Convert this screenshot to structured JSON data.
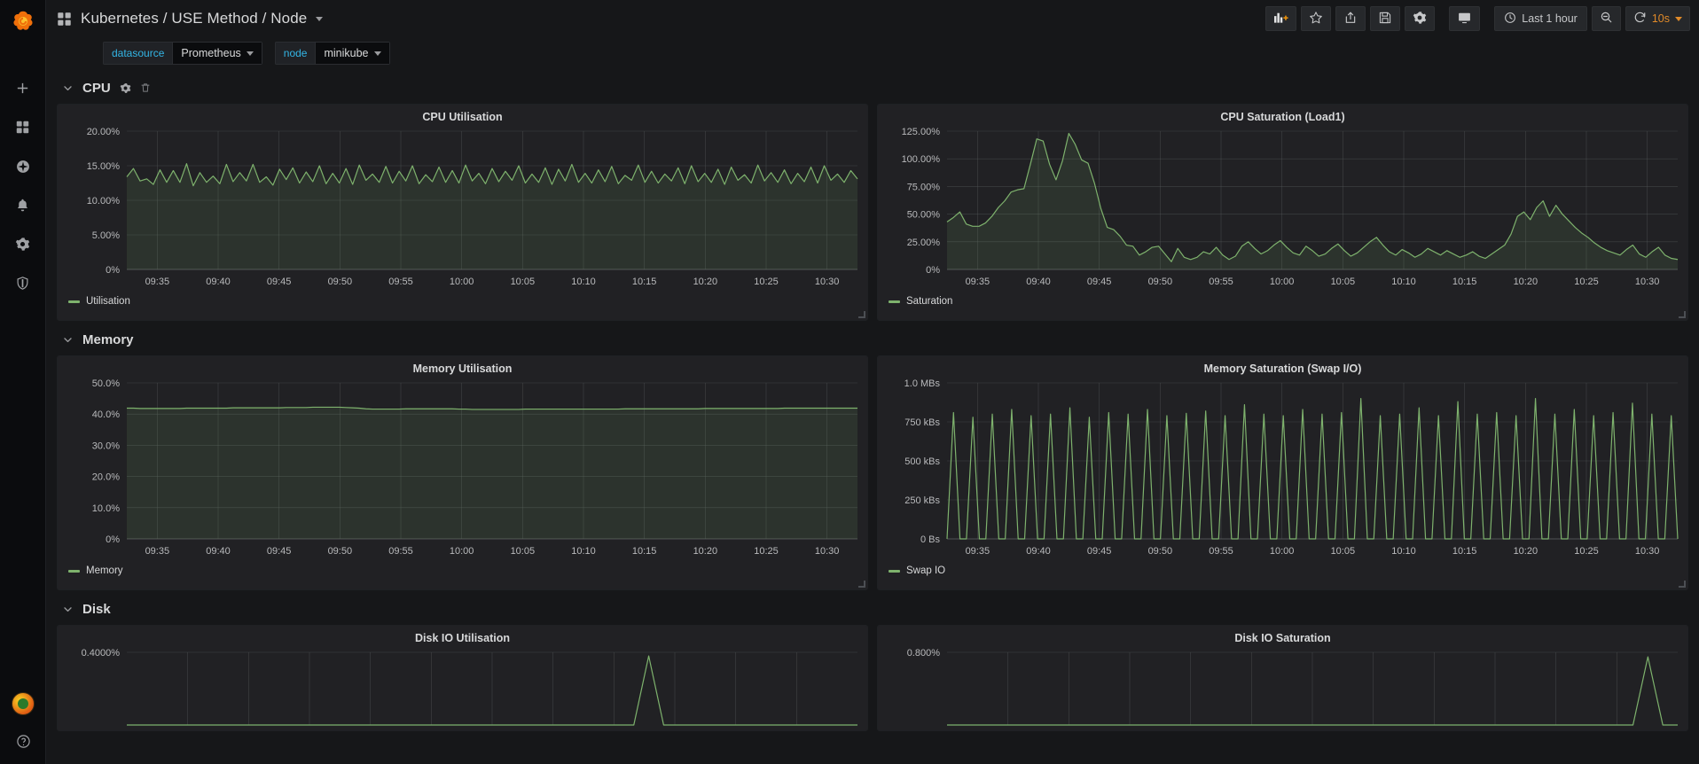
{
  "sidebar": {
    "logo_icon": "grafana-logo-icon",
    "items": [
      {
        "name": "create-button",
        "icon": "plus-icon"
      },
      {
        "name": "dashboards-nav",
        "icon": "apps-grid-icon"
      },
      {
        "name": "explore-nav",
        "icon": "compass-icon"
      },
      {
        "name": "alerting-nav",
        "icon": "bell-icon"
      },
      {
        "name": "configuration-nav",
        "icon": "gear-icon"
      },
      {
        "name": "server-admin-nav",
        "icon": "shield-icon"
      }
    ],
    "bottom": [
      {
        "name": "user-avatar",
        "icon": "avatar-icon"
      },
      {
        "name": "help-nav",
        "icon": "question-circle-icon"
      }
    ]
  },
  "navbar": {
    "dashboard_icon": "dashboard-grid-icon",
    "title": "Kubernetes / USE Method / Node",
    "title_caret": "chevron-down-icon",
    "buttons": [
      {
        "name": "add-panel-button",
        "icon": "add-panel-icon",
        "label": ""
      },
      {
        "name": "star-dashboard-button",
        "icon": "star-icon",
        "label": ""
      },
      {
        "name": "share-dashboard-button",
        "icon": "share-icon",
        "label": ""
      },
      {
        "name": "save-dashboard-button",
        "icon": "save-disk-icon",
        "label": ""
      },
      {
        "name": "dashboard-settings-button",
        "icon": "gear-icon",
        "label": ""
      },
      {
        "name": "kiosk-mode-button",
        "icon": "monitor-icon",
        "label": ""
      }
    ],
    "time_picker": {
      "icon": "clock-icon",
      "label": "Last 1 hour"
    },
    "zoom_out": {
      "icon": "zoom-out-icon"
    },
    "refresh": {
      "icon": "refresh-icon",
      "interval": "10s",
      "caret": "chevron-down-icon"
    }
  },
  "template_vars": [
    {
      "label": "datasource",
      "value": "Prometheus",
      "caret": "chevron-down-icon"
    },
    {
      "label": "node",
      "value": "minikube",
      "caret": "chevron-down-icon"
    }
  ],
  "rows": [
    {
      "title": "CPU",
      "chevron": "chevron-down-icon",
      "actions": [
        {
          "name": "row-settings-button",
          "icon": "gear-icon"
        },
        {
          "name": "row-delete-button",
          "icon": "trash-icon"
        }
      ]
    },
    {
      "title": "Memory",
      "chevron": "chevron-down-icon",
      "actions": []
    },
    {
      "title": "Disk",
      "chevron": "chevron-down-icon",
      "actions": []
    }
  ],
  "panels": {
    "cpu_utilisation": {
      "title": "CPU Utilisation",
      "legend": "Utilisation"
    },
    "cpu_saturation": {
      "title": "CPU Saturation (Load1)",
      "legend": "Saturation"
    },
    "memory_utilisation": {
      "title": "Memory Utilisation",
      "legend": "Memory"
    },
    "memory_saturation": {
      "title": "Memory Saturation (Swap I/O)",
      "legend": "Swap IO"
    },
    "disk_utilisation": {
      "title": "Disk IO Utilisation"
    },
    "disk_saturation": {
      "title": "Disk IO Saturation"
    }
  },
  "colors": {
    "series_green": "#7eb26d",
    "panel_bg": "#212124",
    "page_bg": "#161719",
    "accent_blue": "#33b5e5",
    "accent_orange": "#e08a29"
  },
  "chart_data": [
    {
      "id": "cpu_utilisation",
      "type": "line",
      "title": "CPU Utilisation",
      "xlabel": "",
      "ylabel": "",
      "ylim": [
        0,
        20
      ],
      "ytick_labels": [
        "0%",
        "5.00%",
        "10.00%",
        "15.00%",
        "20.00%"
      ],
      "ytick_values": [
        0,
        5,
        10,
        15,
        20
      ],
      "xtick_labels": [
        "09:35",
        "09:40",
        "09:45",
        "09:50",
        "09:55",
        "10:00",
        "10:05",
        "10:10",
        "10:15",
        "10:20",
        "10:25",
        "10:30"
      ],
      "grid": true,
      "legend": [
        "Utilisation"
      ],
      "legend_position": "bottom-left",
      "series": [
        {
          "name": "Utilisation",
          "color": "#7eb26d",
          "fill": true,
          "values": [
            13.4,
            14.6,
            12.8,
            13.1,
            12.3,
            14.4,
            12.6,
            14.3,
            12.6,
            15.3,
            12.1,
            14.0,
            12.6,
            13.5,
            12.4,
            15.2,
            12.7,
            14.0,
            12.8,
            15.2,
            12.6,
            13.4,
            12.2,
            14.5,
            13.0,
            14.7,
            12.5,
            14.1,
            12.7,
            15.0,
            12.4,
            13.9,
            12.5,
            14.6,
            12.3,
            15.1,
            12.9,
            13.8,
            12.6,
            14.9,
            12.5,
            14.2,
            12.8,
            15.0,
            12.4,
            13.7,
            12.7,
            14.8,
            12.6,
            14.3,
            12.5,
            15.1,
            12.8,
            13.9,
            12.4,
            14.6,
            12.7,
            14.2,
            12.9,
            15.0,
            12.5,
            13.8,
            12.6,
            14.7,
            12.3,
            14.5,
            12.8,
            15.2,
            12.6,
            13.9,
            12.5,
            14.4,
            12.7,
            14.9,
            12.4,
            13.6,
            12.9,
            15.1,
            12.6,
            14.2,
            12.5,
            13.8,
            12.8,
            14.7,
            12.4,
            15.0,
            12.7,
            13.9,
            12.6,
            14.5,
            12.3,
            14.8,
            12.9,
            13.7,
            12.5,
            15.1,
            12.8,
            14.0,
            12.6,
            14.4,
            12.4,
            13.9,
            12.7,
            14.8,
            12.5,
            15.0,
            12.9,
            13.8,
            12.6,
            14.3,
            13.1
          ]
        }
      ]
    },
    {
      "id": "cpu_saturation",
      "type": "line",
      "title": "CPU Saturation (Load1)",
      "xlabel": "",
      "ylabel": "",
      "ylim": [
        0,
        125
      ],
      "ytick_labels": [
        "0%",
        "25.00%",
        "50.00%",
        "75.00%",
        "100.00%",
        "125.00%"
      ],
      "ytick_values": [
        0,
        25,
        50,
        75,
        100,
        125
      ],
      "xtick_labels": [
        "09:35",
        "09:40",
        "09:45",
        "09:50",
        "09:55",
        "10:00",
        "10:05",
        "10:10",
        "10:15",
        "10:20",
        "10:25",
        "10:30"
      ],
      "grid": true,
      "legend": [
        "Saturation"
      ],
      "legend_position": "bottom-left",
      "series": [
        {
          "name": "Saturation",
          "color": "#7eb26d",
          "fill": true,
          "values": [
            43,
            47,
            52,
            41,
            39,
            39,
            42,
            48,
            56,
            62,
            70,
            72,
            73,
            95,
            118,
            116,
            95,
            81,
            98,
            123,
            113,
            99,
            96,
            78,
            55,
            38,
            36,
            30,
            22,
            21,
            13,
            16,
            20,
            21,
            14,
            7,
            19,
            11,
            9,
            11,
            16,
            14,
            20,
            13,
            9,
            12,
            21,
            25,
            19,
            14,
            17,
            22,
            26,
            20,
            15,
            13,
            21,
            17,
            12,
            14,
            19,
            23,
            17,
            12,
            15,
            20,
            25,
            29,
            22,
            16,
            13,
            18,
            15,
            11,
            14,
            19,
            16,
            13,
            17,
            14,
            11,
            13,
            16,
            12,
            10,
            14,
            18,
            22,
            32,
            48,
            52,
            45,
            56,
            62,
            48,
            58,
            50,
            44,
            38,
            33,
            29,
            24,
            20,
            17,
            15,
            13,
            18,
            22,
            14,
            11,
            16,
            20,
            13,
            10,
            9
          ]
        }
      ]
    },
    {
      "id": "memory_utilisation",
      "type": "line",
      "title": "Memory Utilisation",
      "xlabel": "",
      "ylabel": "",
      "ylim": [
        0,
        50
      ],
      "ytick_labels": [
        "0%",
        "10.0%",
        "20.0%",
        "30.0%",
        "40.0%",
        "50.0%"
      ],
      "ytick_values": [
        0,
        10,
        20,
        30,
        40,
        50
      ],
      "xtick_labels": [
        "09:35",
        "09:40",
        "09:45",
        "09:50",
        "09:55",
        "10:00",
        "10:05",
        "10:10",
        "10:15",
        "10:20",
        "10:25",
        "10:30"
      ],
      "grid": true,
      "legend": [
        "Memory"
      ],
      "legend_position": "bottom-left",
      "series": [
        {
          "name": "Memory",
          "color": "#7eb26d",
          "fill": true,
          "values": [
            41.9,
            41.9,
            41.8,
            41.8,
            41.8,
            41.8,
            41.8,
            41.8,
            41.8,
            41.9,
            41.9,
            41.9,
            41.9,
            41.9,
            41.9,
            41.9,
            42.0,
            42.0,
            42.0,
            42.0,
            42.0,
            42.0,
            42.0,
            42.0,
            42.1,
            42.1,
            42.1,
            42.1,
            42.2,
            42.2,
            42.2,
            42.2,
            42.2,
            42.1,
            42.0,
            41.9,
            41.7,
            41.6,
            41.6,
            41.6,
            41.6,
            41.6,
            41.7,
            41.7,
            41.7,
            41.7,
            41.7,
            41.7,
            41.7,
            41.7,
            41.6,
            41.6,
            41.5,
            41.5,
            41.5,
            41.5,
            41.5,
            41.5,
            41.5,
            41.5,
            41.6,
            41.6,
            41.6,
            41.6,
            41.6,
            41.6,
            41.6,
            41.6,
            41.6,
            41.6,
            41.6,
            41.6,
            41.6,
            41.6,
            41.6,
            41.7,
            41.7,
            41.7,
            41.7,
            41.7,
            41.7,
            41.7,
            41.7,
            41.7,
            41.7,
            41.7,
            41.7,
            41.8,
            41.8,
            41.8,
            41.8,
            41.8,
            41.8,
            41.8,
            41.8,
            41.8,
            41.8,
            41.8,
            41.8,
            41.9,
            41.9,
            41.9,
            41.9,
            41.9,
            41.9,
            41.9,
            41.9,
            41.9,
            41.9,
            41.9,
            41.9
          ]
        }
      ]
    },
    {
      "id": "memory_saturation",
      "type": "line",
      "title": "Memory Saturation (Swap I/O)",
      "xlabel": "",
      "ylabel": "",
      "ylim": [
        0,
        1000
      ],
      "ytick_labels": [
        "0 Bs",
        "250 kBs",
        "500 kBs",
        "750 kBs",
        "1.0 MBs"
      ],
      "ytick_values": [
        0,
        250,
        500,
        750,
        1000
      ],
      "xtick_labels": [
        "09:35",
        "09:40",
        "09:45",
        "09:50",
        "09:55",
        "10:00",
        "10:05",
        "10:10",
        "10:15",
        "10:20",
        "10:25",
        "10:30"
      ],
      "grid": true,
      "legend": [
        "Swap IO"
      ],
      "legend_position": "bottom-left",
      "note": "spiky sawtooth: alternating near-zero baseline with ~800 kBs spikes",
      "series": [
        {
          "name": "Swap IO",
          "color": "#7eb26d",
          "fill": false,
          "values": [
            0,
            810,
            0,
            0,
            780,
            0,
            0,
            800,
            0,
            0,
            830,
            0,
            0,
            790,
            0,
            0,
            800,
            0,
            0,
            840,
            0,
            0,
            780,
            0,
            0,
            810,
            0,
            0,
            800,
            0,
            0,
            830,
            0,
            0,
            790,
            0,
            0,
            805,
            0,
            0,
            820,
            0,
            0,
            790,
            0,
            0,
            860,
            0,
            0,
            800,
            0,
            0,
            790,
            0,
            0,
            830,
            0,
            0,
            800,
            0,
            0,
            810,
            0,
            0,
            900,
            0,
            0,
            790,
            0,
            0,
            800,
            0,
            0,
            840,
            0,
            0,
            790,
            0,
            0,
            880,
            0,
            0,
            800,
            0,
            0,
            810,
            0,
            0,
            790,
            0,
            0,
            900,
            0,
            0,
            800,
            0,
            0,
            830,
            0,
            0,
            790,
            0,
            0,
            810,
            0,
            0,
            870,
            0,
            0,
            800,
            0,
            0,
            790,
            0
          ]
        }
      ]
    },
    {
      "id": "disk_utilisation",
      "type": "line",
      "title": "Disk IO Utilisation",
      "xlabel": "",
      "ylabel": "",
      "ylim": [
        0,
        0.4
      ],
      "ytick_labels": [
        "0.4000%"
      ],
      "ytick_values": [
        0.4
      ],
      "xtick_labels": [],
      "grid": true,
      "legend": [],
      "series": [
        {
          "name": "Disk IO Utilisation",
          "color": "#7eb26d",
          "fill": false,
          "values": [
            0,
            0,
            0,
            0,
            0,
            0,
            0,
            0,
            0,
            0,
            0,
            0,
            0,
            0,
            0,
            0,
            0,
            0,
            0,
            0,
            0,
            0,
            0,
            0,
            0,
            0,
            0,
            0,
            0,
            0,
            0,
            0,
            0,
            0,
            0,
            0.38,
            0,
            0,
            0,
            0,
            0,
            0,
            0,
            0,
            0,
            0,
            0,
            0,
            0,
            0
          ]
        }
      ]
    },
    {
      "id": "disk_saturation",
      "type": "line",
      "title": "Disk IO Saturation",
      "xlabel": "",
      "ylabel": "",
      "ylim": [
        0,
        0.8
      ],
      "ytick_labels": [
        "0.800%"
      ],
      "ytick_values": [
        0.8
      ],
      "xtick_labels": [],
      "grid": true,
      "legend": [],
      "series": [
        {
          "name": "Disk IO Saturation",
          "color": "#7eb26d",
          "fill": false,
          "values": [
            0,
            0,
            0,
            0,
            0,
            0,
            0,
            0,
            0,
            0,
            0,
            0,
            0,
            0,
            0,
            0,
            0,
            0,
            0,
            0,
            0,
            0,
            0,
            0,
            0,
            0,
            0,
            0,
            0,
            0,
            0,
            0,
            0,
            0,
            0,
            0,
            0,
            0,
            0,
            0,
            0,
            0,
            0,
            0,
            0,
            0,
            0,
            0.75,
            0,
            0
          ]
        }
      ]
    }
  ]
}
